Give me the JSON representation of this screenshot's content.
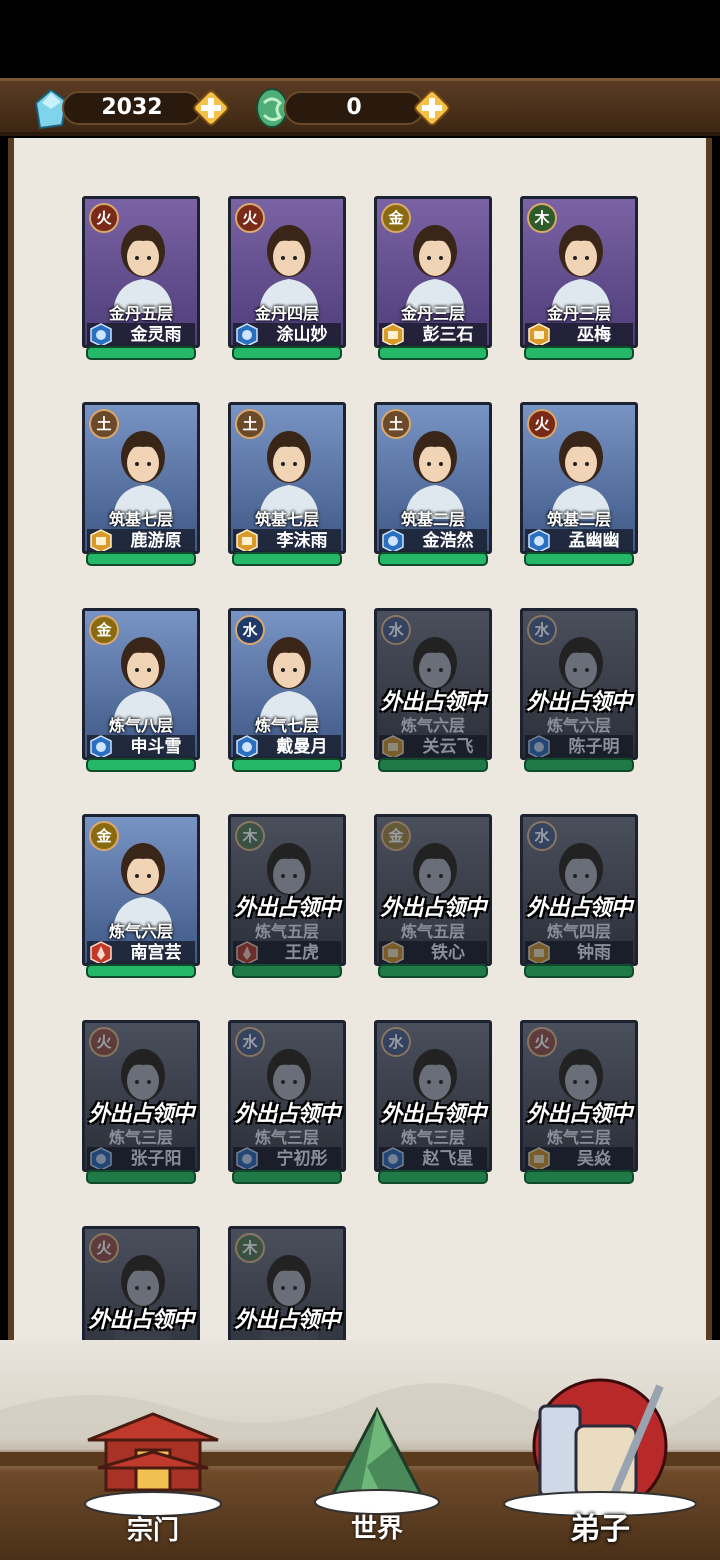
{
  "currency": {
    "spirit_stones": "2032",
    "jade": "0"
  },
  "occupied_label": "外出占领中",
  "disciples": [
    {
      "realm": "金丹五层",
      "name": "金灵雨",
      "element": "火",
      "style": "purple",
      "faction": "water",
      "active": true
    },
    {
      "realm": "金丹四层",
      "name": "涂山妙",
      "element": "火",
      "style": "purple",
      "faction": "water",
      "active": true
    },
    {
      "realm": "金丹三层",
      "name": "彭三石",
      "element": "金",
      "style": "purple",
      "faction": "earth",
      "active": true
    },
    {
      "realm": "金丹三层",
      "name": "巫梅",
      "element": "木",
      "style": "purple",
      "faction": "earth",
      "active": true
    },
    {
      "realm": "筑基七层",
      "name": "鹿游原",
      "element": "土",
      "style": "blue",
      "faction": "earth",
      "active": true
    },
    {
      "realm": "筑基七层",
      "name": "李沫雨",
      "element": "土",
      "style": "blue",
      "faction": "earth",
      "active": true
    },
    {
      "realm": "筑基二层",
      "name": "金浩然",
      "element": "土",
      "style": "blue",
      "faction": "water",
      "active": true
    },
    {
      "realm": "筑基二层",
      "name": "孟幽幽",
      "element": "火",
      "style": "blue",
      "faction": "water",
      "active": true
    },
    {
      "realm": "炼气八层",
      "name": "申斗雪",
      "element": "金",
      "style": "blue",
      "faction": "water",
      "active": true
    },
    {
      "realm": "炼气七层",
      "name": "戴曼月",
      "element": "水",
      "style": "blue",
      "faction": "water",
      "active": true
    },
    {
      "realm": "炼气六层",
      "name": "关云飞",
      "element": "水",
      "style": "dim",
      "faction": "earth",
      "active": false
    },
    {
      "realm": "炼气六层",
      "name": "陈子明",
      "element": "水",
      "style": "dim",
      "faction": "water",
      "active": false
    },
    {
      "realm": "炼气六层",
      "name": "南宫芸",
      "element": "金",
      "style": "blue",
      "faction": "fire",
      "active": true
    },
    {
      "realm": "炼气五层",
      "name": "王虎",
      "element": "木",
      "style": "dim",
      "faction": "fire",
      "active": false
    },
    {
      "realm": "炼气五层",
      "name": "铁心",
      "element": "金",
      "style": "dim",
      "faction": "earth",
      "active": false
    },
    {
      "realm": "炼气四层",
      "name": "钟雨",
      "element": "水",
      "style": "dim",
      "faction": "earth",
      "active": false
    },
    {
      "realm": "炼气三层",
      "name": "张子阳",
      "element": "火",
      "style": "dim",
      "faction": "water",
      "active": false
    },
    {
      "realm": "炼气三层",
      "name": "宁初彤",
      "element": "水",
      "style": "dim",
      "faction": "water",
      "active": false
    },
    {
      "realm": "炼气三层",
      "name": "赵飞星",
      "element": "水",
      "style": "dim",
      "faction": "water",
      "active": false
    },
    {
      "realm": "炼气三层",
      "name": "吴焱",
      "element": "火",
      "style": "dim",
      "faction": "earth",
      "active": false
    },
    {
      "realm": "",
      "name": "",
      "element": "火",
      "style": "dim",
      "faction": "water",
      "active": false
    },
    {
      "realm": "",
      "name": "",
      "element": "木",
      "style": "dim",
      "faction": "water",
      "active": false
    }
  ],
  "nav": {
    "sect": "宗门",
    "world": "世界",
    "disciples": "弟子"
  },
  "colors": {
    "bar_brown": "#4a3018",
    "panel_bg": "#ece8df",
    "health_green": "#24b868"
  }
}
